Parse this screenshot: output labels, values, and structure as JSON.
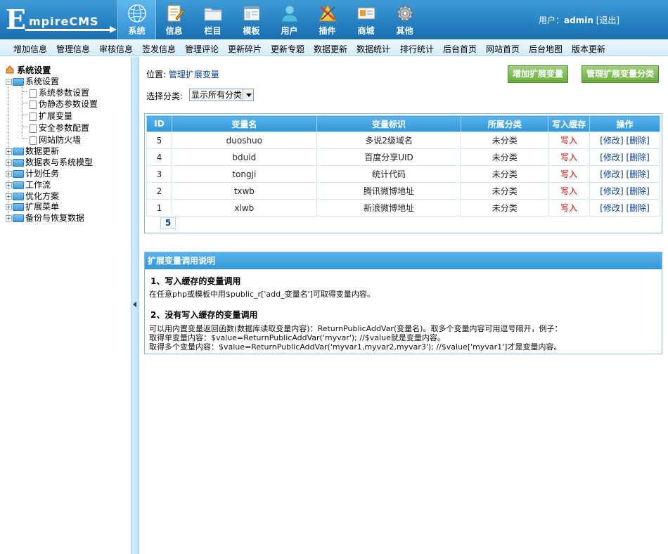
{
  "logo": {
    "initial": "E",
    "rest": "mpireCMS"
  },
  "nav": [
    {
      "label": "系统",
      "icon": "globe-icon"
    },
    {
      "label": "信息",
      "icon": "document-edit-icon"
    },
    {
      "label": "栏目",
      "icon": "folder-icon"
    },
    {
      "label": "模板",
      "icon": "window-icon"
    },
    {
      "label": "用户",
      "icon": "user-icon"
    },
    {
      "label": "插件",
      "icon": "tools-icon"
    },
    {
      "label": "商城",
      "icon": "id-card-icon"
    },
    {
      "label": "其他",
      "icon": "gear-icon"
    }
  ],
  "user": {
    "prefix": "用户：",
    "name": "admin",
    "logout": "[退出]"
  },
  "submenu": [
    "增加信息",
    "管理信息",
    "审核信息",
    "签发信息",
    "管理评论",
    "更新碎片",
    "更新专题",
    "数据更新",
    "数据统计",
    "排行统计",
    "后台首页",
    "网站首页",
    "后台地图",
    "版本更新"
  ],
  "tree": {
    "root": "系统设置",
    "open_node": "系统设置",
    "children": [
      "系统参数设置",
      "伪静态参数设置",
      "扩展变量",
      "安全参数配置",
      "网站防火墙"
    ],
    "collapsed": [
      "数据更新",
      "数据表与系统模型",
      "计划任务",
      "工作流",
      "优化方案",
      "扩展菜单",
      "备份与恢复数据"
    ]
  },
  "main": {
    "position_prefix": "位置: ",
    "position_link": "管理扩展变量",
    "btn_add": "增加扩展变量",
    "btn_manage_class": "管理扩展变量分类",
    "category_label": "选择分类:",
    "category_value": "显示所有分类",
    "table": {
      "headers": [
        "ID",
        "变量名",
        "变量标识",
        "所属分类",
        "写入缓存",
        "操作"
      ],
      "rows": [
        {
          "id": "5",
          "name": "duoshuo",
          "label": "多说2级域名",
          "category": "未分类",
          "cache": "写入",
          "edit": "[修改]",
          "del": "[删除]"
        },
        {
          "id": "4",
          "name": "bduid",
          "label": "百度分享UID",
          "category": "未分类",
          "cache": "写入",
          "edit": "[修改]",
          "del": "[删除]"
        },
        {
          "id": "3",
          "name": "tongji",
          "label": "统计代码",
          "category": "未分类",
          "cache": "写入",
          "edit": "[修改]",
          "del": "[删除]"
        },
        {
          "id": "2",
          "name": "txwb",
          "label": "腾讯微博地址",
          "category": "未分类",
          "cache": "写入",
          "edit": "[修改]",
          "del": "[删除]"
        },
        {
          "id": "1",
          "name": "xlwb",
          "label": "新浪微博地址",
          "category": "未分类",
          "cache": "写入",
          "edit": "[修改]",
          "del": "[删除]"
        }
      ]
    },
    "pager": "5",
    "help": {
      "title": "扩展变量调用说明",
      "h1": "1、写入缓存的变量调用",
      "t1": "在任意php或模板中用$public_r['add_变量名']可取得变量内容。",
      "h2": "2、没有写入缓存的变量调用",
      "t2a": "可以用内置变量返回函数(数据库读取变量内容)：ReturnPublicAddVar(变量名)。取多个变量内容可用逗号隔开，例子：",
      "t2b": "取得单变量内容：$value=ReturnPublicAddVar('myvar'); //$value就是变量内容。",
      "t2c": "取得多个变量内容：$value=ReturnPublicAddVar('myvar1,myvar2,myvar3'); //$value['myvar1']才是变量内容。"
    }
  }
}
